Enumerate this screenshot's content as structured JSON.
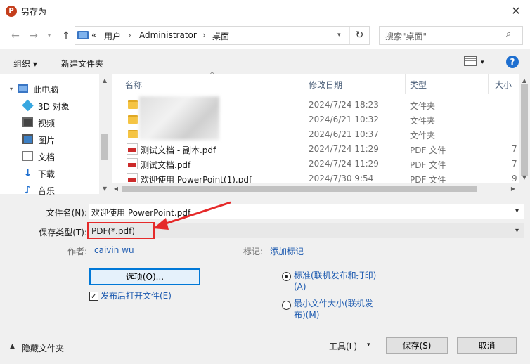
{
  "window": {
    "title": "另存为",
    "app_icon_letter": "P"
  },
  "address": {
    "overflow": "«",
    "crumbs": [
      "用户",
      "Administrator",
      "桌面"
    ],
    "search_placeholder": "搜索\"桌面\""
  },
  "toolbar": {
    "organize": "组织 ▾",
    "new_folder": "新建文件夹",
    "view_dropdown": "▾",
    "help": "?"
  },
  "nav": {
    "items": [
      {
        "label": "此电脑",
        "icon": "computer-icon"
      },
      {
        "label": "3D 对象",
        "icon": "cube-icon"
      },
      {
        "label": "视频",
        "icon": "video-icon"
      },
      {
        "label": "图片",
        "icon": "picture-icon"
      },
      {
        "label": "文档",
        "icon": "document-icon"
      },
      {
        "label": "下载",
        "icon": "download-icon"
      },
      {
        "label": "音乐",
        "icon": "music-icon"
      }
    ]
  },
  "columns": {
    "name": "名称",
    "date": "修改日期",
    "type": "类型",
    "size": "大小"
  },
  "files": [
    {
      "name": "",
      "date": "2024/7/24 18:23",
      "type": "文件夹",
      "size": "",
      "kind": "folder"
    },
    {
      "name": "",
      "date": "2024/6/21 10:32",
      "type": "文件夹",
      "size": "",
      "kind": "folder"
    },
    {
      "name": "",
      "date": "2024/6/21 10:37",
      "type": "文件夹",
      "size": "",
      "kind": "folder"
    },
    {
      "name": "测试文档 - 副本.pdf",
      "date": "2024/7/24 11:29",
      "type": "PDF 文件",
      "size": "7",
      "kind": "pdf"
    },
    {
      "name": "测试文档.pdf",
      "date": "2024/7/24 11:29",
      "type": "PDF 文件",
      "size": "7",
      "kind": "pdf"
    },
    {
      "name": "欢迎使用 PowerPoint(1).pdf",
      "date": "2024/7/30 9:54",
      "type": "PDF 文件",
      "size": "9",
      "kind": "pdf"
    }
  ],
  "form": {
    "filename_label": "文件名(N):",
    "filename_value": "欢迎使用 PowerPoint.pdf",
    "filetype_label": "保存类型(T):",
    "filetype_value": "PDF(*.pdf)",
    "author_label": "作者:",
    "author_value": "caivin wu",
    "tags_label": "标记:",
    "tags_value": "添加标记",
    "options_button": "选项(O)...",
    "open_after_publish": "发布后打开文件(E)",
    "open_after_publish_checked": true,
    "radio_standard_line1": "标准(联机发布和打印)",
    "radio_standard_line2": "(A)",
    "radio_min_line1": "最小文件大小(联机发",
    "radio_min_line2": "布)(M)",
    "selected_radio": "standard"
  },
  "footer": {
    "hide_folders": "隐藏文件夹",
    "tools": "工具(L)",
    "save": "保存(S)",
    "cancel": "取消"
  },
  "colors": {
    "annotation_red": "#e52a2a",
    "link_blue": "#1e5bb0",
    "focus_blue": "#0078d7"
  }
}
